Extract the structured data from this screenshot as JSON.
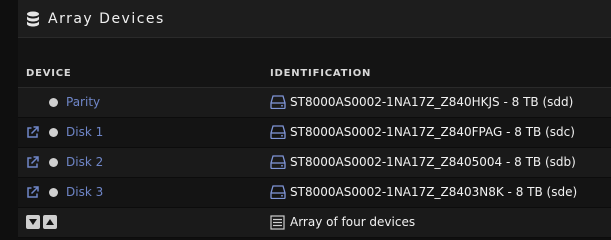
{
  "panel": {
    "title": "Array Devices"
  },
  "columns": {
    "device": "DEVICE",
    "identification": "IDENTIFICATION"
  },
  "rows": [
    {
      "name": "Parity",
      "ident": "ST8000AS0002-1NA17Z_Z840HKJS - 8 TB (sdd)",
      "external_link": false
    },
    {
      "name": "Disk 1",
      "ident": "ST8000AS0002-1NA17Z_Z840FPAG - 8 TB (sdc)",
      "external_link": true
    },
    {
      "name": "Disk 2",
      "ident": "ST8000AS0002-1NA17Z_Z8405004 - 8 TB (sdb)",
      "external_link": true
    },
    {
      "name": "Disk 3",
      "ident": "ST8000AS0002-1NA17Z_Z8403N8K - 8 TB (sde)",
      "external_link": true
    }
  ],
  "footer": {
    "summary": "Array of four devices"
  },
  "icons": {
    "title": "database-icon",
    "external": "external-link-icon",
    "status": "status-dot-icon",
    "drive": "hard-drive-icon",
    "summary": "list-icon",
    "collapse": "caret-down-icon",
    "expand": "caret-up-icon"
  },
  "colors": {
    "link": "#6f86c8",
    "drive_icon": "#7f95d6"
  }
}
